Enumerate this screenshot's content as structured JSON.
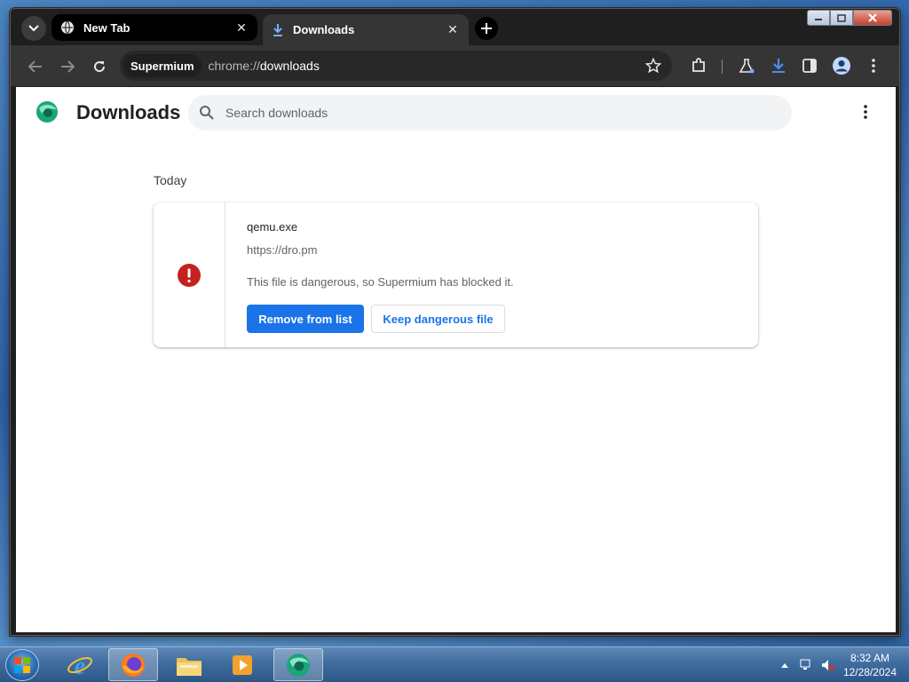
{
  "browser": {
    "tabs": [
      {
        "title": "New Tab",
        "active": false,
        "icon": "globe-icon"
      },
      {
        "title": "Downloads",
        "active": true,
        "icon": "download-icon"
      }
    ],
    "omnibox": {
      "chip": "Supermium",
      "scheme": "chrome://",
      "host": "downloads"
    }
  },
  "downloads_page": {
    "title": "Downloads",
    "search_placeholder": "Search downloads",
    "date_heading": "Today",
    "items": [
      {
        "file_name": "qemu.exe",
        "source_url": "https://dro.pm",
        "description": "This file is dangerous, so Supermium has blocked it.",
        "primary_action": "Remove from list",
        "secondary_action": "Keep dangerous file",
        "status_icon": "error-icon"
      }
    ]
  },
  "taskbar": {
    "apps": [
      "internet-explorer",
      "firefox",
      "file-explorer",
      "media-player",
      "supermium"
    ],
    "clock_time": "8:32 AM",
    "clock_date": "12/28/2024"
  },
  "colors": {
    "accent": "#1a73e8",
    "danger": "#c5221f",
    "frame": "#1f1f1f"
  }
}
